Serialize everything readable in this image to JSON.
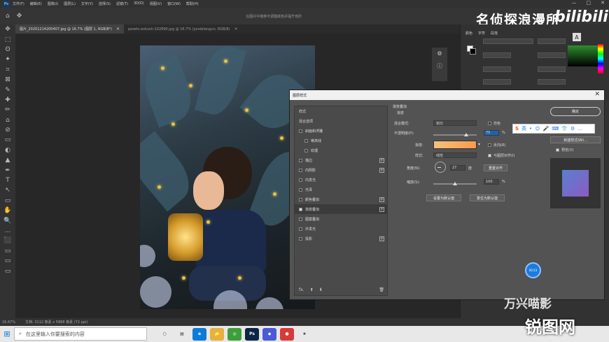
{
  "menubar": {
    "logo": "Ps",
    "items": [
      "文件(F)",
      "编辑(E)",
      "图像(I)",
      "图层(L)",
      "文字(Y)",
      "选择(S)",
      "滤镜(T)",
      "3D(D)",
      "视图(V)",
      "窗口(W)",
      "帮助(H)"
    ],
    "window_controls": [
      "—",
      "□",
      "✕"
    ]
  },
  "options_bar": {
    "home_icon": "⌂",
    "move_icon": "✥",
    "hint": "在图片中拖移可调整颜色并提升色阶"
  },
  "brand": {
    "text": "名侦探浪漫所",
    "bilibili": "bilibili"
  },
  "doc_tabs": [
    {
      "label": "图片_20201214200407.jpg @ 16.7% (图层 1, RGB/8*)",
      "close": "×",
      "active": true
    },
    {
      "label": "pexels-ankush-102890.jpg @ 16.7% (juneblangun, RGB/8)",
      "close": "×",
      "active": false
    }
  ],
  "tools": [
    "✥",
    "⬚",
    "ʘ",
    "✦",
    "⌗",
    "⊠",
    "✎",
    "✚",
    "✏",
    "⌂",
    "⊘",
    "▭",
    "◐",
    "▲",
    "✒",
    "T",
    "↖",
    "▭",
    "✋",
    "🔍",
    "…",
    "⬛",
    "▭",
    "▭",
    "▭"
  ],
  "right_panel": {
    "color_tab": "颜色",
    "char_tabs": [
      "字符",
      "段落"
    ],
    "char_icon": "A"
  },
  "status": {
    "zoom": "16.67%",
    "doc": "文档: 3112 像素 x 5888 像素 (72 ppi)"
  },
  "dialog": {
    "title": "图层样式",
    "close": "✕",
    "styles_header": "样式",
    "blend_options": "混合选项",
    "items": [
      {
        "label": "斜面和浮雕",
        "checked": false,
        "sub": false,
        "plus": false,
        "active": false
      },
      {
        "label": "等高线",
        "checked": false,
        "sub": true,
        "plus": false,
        "active": false
      },
      {
        "label": "纹理",
        "checked": false,
        "sub": true,
        "plus": false,
        "active": false
      },
      {
        "label": "描边",
        "checked": false,
        "sub": false,
        "plus": true,
        "active": false
      },
      {
        "label": "内阴影",
        "checked": false,
        "sub": false,
        "plus": true,
        "active": false
      },
      {
        "label": "内发光",
        "checked": false,
        "sub": false,
        "plus": false,
        "active": false
      },
      {
        "label": "光泽",
        "checked": false,
        "sub": false,
        "plus": false,
        "active": false
      },
      {
        "label": "颜色叠加",
        "checked": false,
        "sub": false,
        "plus": true,
        "active": false
      },
      {
        "label": "渐变叠加",
        "checked": true,
        "sub": false,
        "plus": true,
        "active": true
      },
      {
        "label": "图案叠加",
        "checked": false,
        "sub": false,
        "plus": false,
        "active": false
      },
      {
        "label": "外发光",
        "checked": false,
        "sub": false,
        "plus": false,
        "active": false
      },
      {
        "label": "投影",
        "checked": false,
        "sub": false,
        "plus": true,
        "active": false
      }
    ],
    "footer": {
      "fx": "fx.",
      "up": "⬆",
      "down": "⬇",
      "trash": "🗑"
    },
    "gradient": {
      "section": "渐变叠加",
      "subsection": "渐变",
      "blend_mode_label": "混合模式:",
      "blend_mode": "划分",
      "dither_label": "仿色",
      "opacity_label": "不透明度(P):",
      "opacity": "75",
      "opacity_fraction": 0.75,
      "percent": "%",
      "gradient_label": "渐变:",
      "gradient_colors": [
        "#f4c27a",
        "#f79a4d"
      ],
      "reverse_label": "反向(R)",
      "style_label": "样式:",
      "style": "线性",
      "align_label": "与图层对齐(I)",
      "angle_label": "角度(N):",
      "angle": "27",
      "degree": "度",
      "reset_align": "重置对齐",
      "scale_label": "缩放(S):",
      "scale": "100",
      "scale_fraction": 1.0,
      "default_btn": "设置为默认值",
      "reset_btn": "复位为默认值"
    },
    "ok": "确定",
    "new_style": "新建样式(W)...",
    "preview_label": "预览(V)"
  },
  "ime": {
    "logo": "S",
    "items": [
      "英",
      "•",
      "☺",
      "🎤",
      "⌨",
      "👕",
      "⚙",
      "…"
    ]
  },
  "taskbar": {
    "search_placeholder": "在这里输入你要搜索的内容",
    "search_icon": "⌕",
    "apps": [
      {
        "label": "○",
        "color": "#e8e8e8"
      },
      {
        "label": "▤",
        "color": "#e8e8e8"
      },
      {
        "label": "e",
        "color": "#0a7bd8"
      },
      {
        "label": "📁",
        "color": "#e6b13c"
      },
      {
        "label": "◎",
        "color": "#3c9f3a"
      },
      {
        "label": "Ps",
        "color": "#0b2545"
      },
      {
        "label": "◆",
        "color": "#4a5ad8"
      },
      {
        "label": "●",
        "color": "#d83a3a"
      },
      {
        "label": "★",
        "color": "#e8e8e8"
      }
    ]
  },
  "watermark": {
    "brand": "万兴喵影",
    "site": "锐图网"
  },
  "blue_circle": "00:23"
}
